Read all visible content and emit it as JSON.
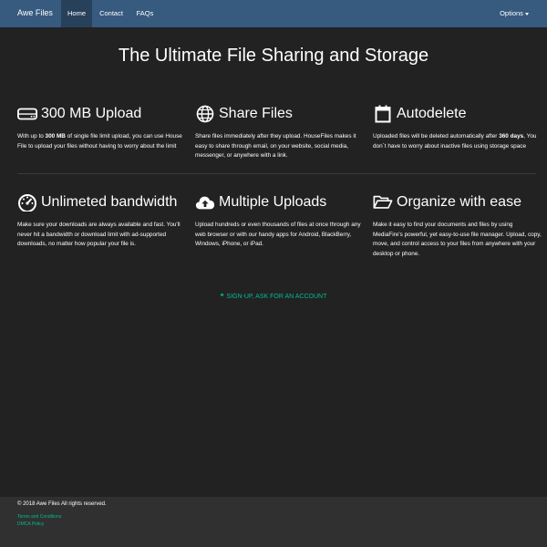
{
  "navbar": {
    "brand": "Awe Files",
    "items": [
      {
        "label": "Home"
      },
      {
        "label": "Contact"
      },
      {
        "label": "FAQs"
      }
    ],
    "options_label": "Options"
  },
  "hero": {
    "title": "The Ultimate File Sharing and Storage"
  },
  "features": [
    {
      "icon": "hard-drive-icon",
      "heading": "300 MB Upload",
      "desc_pre": "With up to ",
      "desc_bold": "300 MB",
      "desc_post": " of single file limit upload, you can use House File to upload your files without having to worry about the limit"
    },
    {
      "icon": "globe-icon",
      "heading": "Share Files",
      "desc": "Share files immediately after they upload. HouseFiles makes it easy to share through email, on your website, social media, messenger, or anywhere with a link."
    },
    {
      "icon": "calendar-icon",
      "heading": "Autodelete",
      "desc_pre": "Uploaded files will be deleted automatically after ",
      "desc_bold": "360 days",
      "desc_post": ", You don´t have to worry about inactive files using storage space"
    },
    {
      "icon": "dashboard-icon",
      "heading": "Unlimeted bandwidth",
      "desc": "Make sure your downloads are always available and fast. You'll never hit a bandwidth or download limit with ad-supported downloads, no matter how popular your file is."
    },
    {
      "icon": "cloud-upload-icon",
      "heading": "Multiple Uploads",
      "desc": "Upload hundreds or even thousands of files at once through any web browser or with our handy apps for Android, BlackBerry, Windows, iPhone, or iPad."
    },
    {
      "icon": "folder-open-icon",
      "heading": "Organize with ease",
      "desc": "Make it easy to find your documents and files by using MediaFire's powerful, yet easy-to-use file manager. Upload, copy, move, and control access to your files from anywhere with your desktop or phone."
    }
  ],
  "signup": {
    "quote_glyph": "❝",
    "label": "SIGN-UP, ASK FOR AN ACCOUNT"
  },
  "footer": {
    "copyright": "© 2018 Awe Files All rights reserved.",
    "links": [
      {
        "label": "Terms and Conditions"
      },
      {
        "label": "DMCA Policy"
      }
    ]
  },
  "colors": {
    "navbar": "#375a7f",
    "navbar_active": "#28415b",
    "background": "#222222",
    "footer": "#303030",
    "accent": "#00bc8c"
  }
}
